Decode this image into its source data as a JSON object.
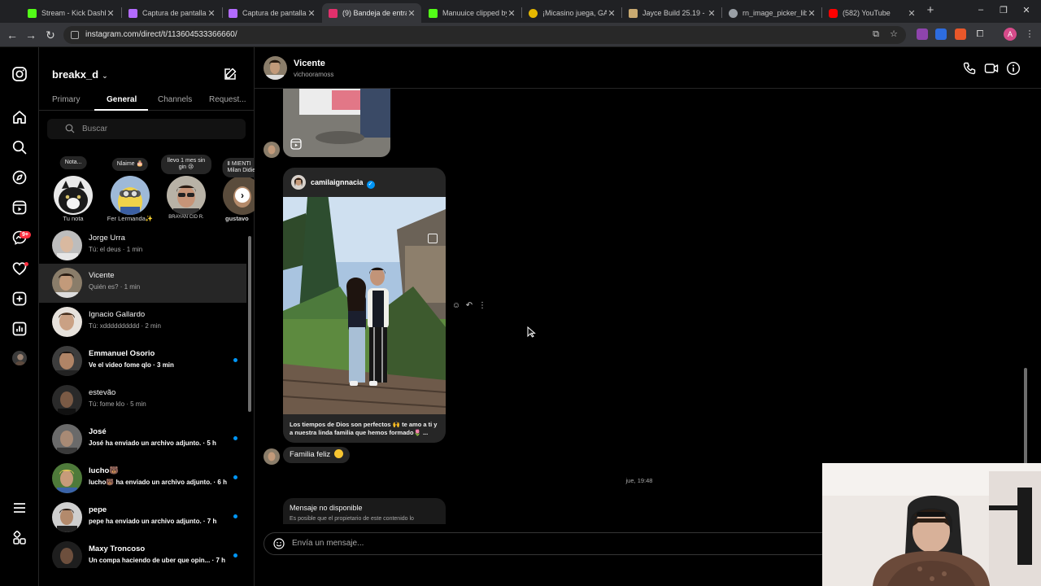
{
  "browser": {
    "tabs": [
      {
        "title": "Stream - Kick Dashbo",
        "color": "#53fc18"
      },
      {
        "title": "Captura de pantalla p",
        "color": "#b36bff"
      },
      {
        "title": "Captura de pantalla p",
        "color": "#b36bff"
      },
      {
        "title": "(9) Bandeja de entrad",
        "color": "#e1306c"
      },
      {
        "title": "Manuuice clipped by",
        "color": "#53fc18"
      },
      {
        "title": "¡Micasino juega, GAN",
        "color": "#e6b800"
      },
      {
        "title": "Jayce Build 25.19 - R",
        "color": "#c9aa71"
      },
      {
        "title": "rn_image_picker_lib_",
        "color": "#9aa0a6"
      },
      {
        "title": "(582) YouTube",
        "color": "#ff0000"
      }
    ],
    "url": "instagram.com/direct/t/113604533366660/"
  },
  "inbox": {
    "username": "breakx_d",
    "tabs": [
      "Primary",
      "General",
      "Channels",
      "Request..."
    ],
    "active_tab": "General",
    "search_placeholder": "Buscar",
    "notes": [
      {
        "bubble": "Nota...",
        "name": "Tu nota"
      },
      {
        "bubble": "Nlaime 🎂",
        "name": "Fer Lermanda✨"
      },
      {
        "bubble": "llevo 1 mes sin gin 😢",
        "name": "BRAYAN CID R."
      },
      {
        "bubble": "Ⅱ MIENTI\nMilan Didier",
        "name": "gustavo"
      }
    ],
    "notif_badge": "9+",
    "threads": [
      {
        "name": "Jorge Urra",
        "preview": "Tú: el deus · 1 min",
        "unread": false
      },
      {
        "name": "Vicente",
        "preview": "Quién es? · 1 min",
        "unread": false,
        "selected": true
      },
      {
        "name": "Ignacio Gallardo",
        "preview": "Tú: xdddddddddd · 2 min",
        "unread": false
      },
      {
        "name": "Emmanuel Osorio",
        "preview": "Ve el video fome qlo · 3 min",
        "unread": true
      },
      {
        "name": "estevão",
        "preview": "Tú: fome klo · 5 min",
        "unread": false
      },
      {
        "name": "José",
        "preview": "José ha enviado un archivo adjunto. · 5 h",
        "unread": true
      },
      {
        "name": "lucho🐻",
        "preview": "lucho🐻 ha enviado un archivo adjunto. · 6 h",
        "unread": true
      },
      {
        "name": "pepe",
        "preview": "pepe ha enviado un archivo adjunto. · 7 h",
        "unread": true
      },
      {
        "name": "Maxy Troncoso",
        "preview": "Un compa haciendo de uber que opin... · 7 h",
        "unread": true
      }
    ]
  },
  "chat": {
    "name": "Vicente",
    "username": "vichooramoss",
    "share": {
      "username": "camilaignnacia",
      "caption": "Los tiempos de Dios son perfectos 🙌 te amo a ti y a nuestra linda familia que hemos formado🌷 ..."
    },
    "bubble_text": "Familia feliz",
    "timestamp": "jue, 19:48",
    "unavailable_title": "Mensaje no disponible",
    "unavailable_sub": "Es posible que el propietario de este contenido lo",
    "composer_placeholder": "Envía un mensaje..."
  }
}
